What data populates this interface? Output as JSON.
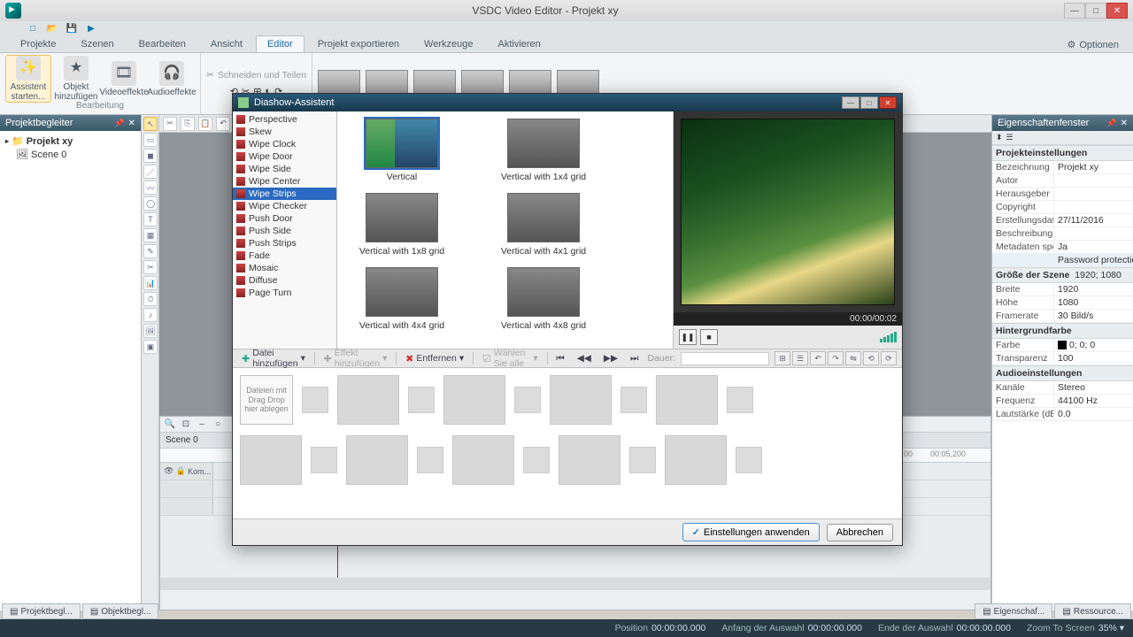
{
  "app": {
    "title": "VSDC Video Editor - Projekt xy",
    "options_label": "Optionen"
  },
  "menu": {
    "tabs": [
      "Projekte",
      "Szenen",
      "Bearbeiten",
      "Ansicht",
      "Editor",
      "Projekt exportieren",
      "Werkzeuge",
      "Aktivieren"
    ],
    "active_index": 4
  },
  "ribbon": {
    "assist": "Assistent starten...",
    "add_obj": "Objekt hinzufügen",
    "videofx": "Videoeffekte",
    "audiofx": "Audioeffekte",
    "group_label": "Bearbeitung",
    "cut_split": "Schneiden und Teilen"
  },
  "left": {
    "title": "Projektbegleiter",
    "project": "Projekt xy",
    "scene": "Scene 0"
  },
  "timeline": {
    "scene_tab": "Scene 0",
    "track0": "Kom...",
    "times": [
      "00",
      "00:05,200"
    ]
  },
  "right": {
    "title": "Eigenschaftenfenster",
    "sections": {
      "proj": "Projekteinstellungen",
      "scene": "Größe der Szene",
      "bg": "Hintergrundfarbe",
      "audio": "Audioeinstellungen"
    },
    "rows": {
      "bez": {
        "k": "Bezeichnung",
        "v": "Projekt xy"
      },
      "autor": {
        "k": "Autor",
        "v": ""
      },
      "heraus": {
        "k": "Herausgeber",
        "v": ""
      },
      "copy": {
        "k": "Copyright",
        "v": ""
      },
      "erst": {
        "k": "Erstellungsdatum",
        "v": "27/11/2016"
      },
      "besch": {
        "k": "Beschreibung",
        "v": ""
      },
      "meta": {
        "k": "Metadaten speic",
        "v": "Ja"
      },
      "pwd": {
        "k": "",
        "v": "Password protection"
      },
      "scene": {
        "k": "Größe der Szene",
        "v": "1920; 1080"
      },
      "breite": {
        "k": "Breite",
        "v": "1920"
      },
      "hoehe": {
        "k": "Höhe",
        "v": "1080"
      },
      "framerate": {
        "k": "Framerate",
        "v": "30 Bild/s"
      },
      "farbe": {
        "k": "Farbe",
        "v": "0; 0; 0"
      },
      "trans": {
        "k": "Transparenz",
        "v": "100"
      },
      "kanaele": {
        "k": "Kanäle",
        "v": "Stereo"
      },
      "freq": {
        "k": "Frequenz",
        "v": "44100 Hz"
      },
      "laut": {
        "k": "Lautstärke (dB",
        "v": "0.0"
      }
    }
  },
  "bottom_tabs": {
    "left": [
      "Objektbegl...",
      "Projektbegl..."
    ],
    "right": [
      "Eigenschaf...",
      "Ressource..."
    ]
  },
  "status": {
    "pos": {
      "label": "Position",
      "v": "00:00:00.000"
    },
    "sel_start": {
      "label": "Anfang der Auswahl",
      "v": "00:00:00.000"
    },
    "sel_end": {
      "label": "Ende der Auswahl",
      "v": "00:00:00.000"
    },
    "zoom": {
      "label": "Zoom To Screen",
      "v": "35%"
    }
  },
  "modal": {
    "title": "Diashow-Assistent",
    "effects": [
      "Perspective",
      "Skew",
      "Wipe Clock",
      "Wipe Door",
      "Wipe Side",
      "Wipe Center",
      "Wipe Strips",
      "Wipe Checker",
      "Push Door",
      "Push Side",
      "Push Strips",
      "Fade",
      "Mosaic",
      "Diffuse",
      "Page Turn"
    ],
    "effect_selected": 6,
    "gallery": [
      {
        "label": "Vertical",
        "color": true,
        "sel": true
      },
      {
        "label": "Vertical with 1x4 grid"
      },
      {
        "label": "Vertical with 1x8 grid"
      },
      {
        "label": "Vertical with 4x1 grid"
      },
      {
        "label": "Vertical with 4x4 grid"
      },
      {
        "label": "Vertical with 4x8 grid"
      }
    ],
    "preview_time": "00:00/00:02",
    "toolbar": {
      "add_file": "Datei hinzufügen",
      "add_effect": "Effekt hinzufügen",
      "remove": "Entfernen",
      "select_all": "Wählen Sie alle",
      "duration_label": "Dauer:"
    },
    "dropzone": "Dateien mit Drag Drop hier ablegen",
    "apply": "Einstellungen anwenden",
    "cancel": "Abbrechen"
  }
}
